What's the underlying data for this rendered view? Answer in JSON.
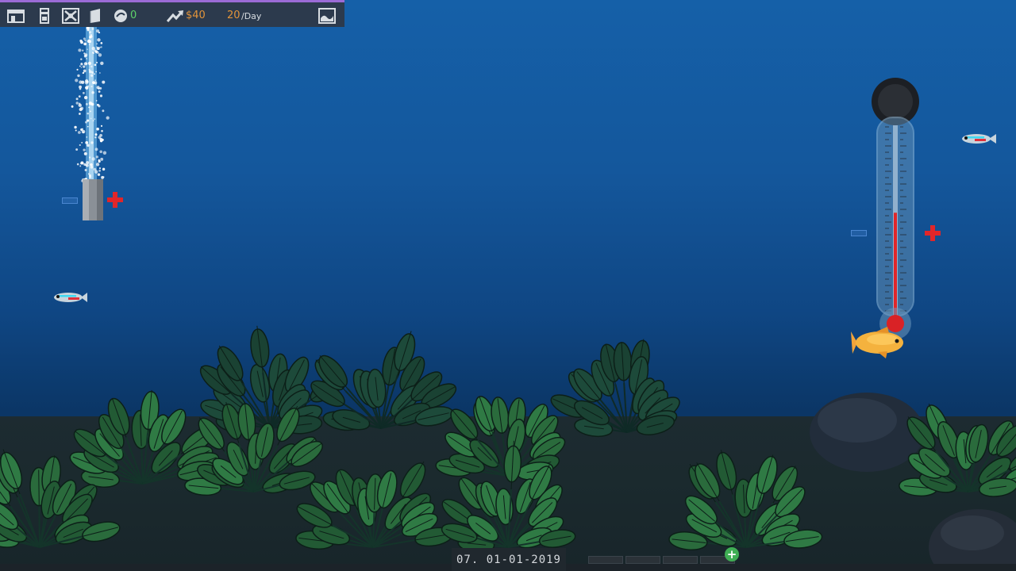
{
  "hud": {
    "pearl_count": "0",
    "money": "$40",
    "income_value": "20",
    "income_unit": "/Day",
    "icons": [
      "shop-icon",
      "equipment-icon",
      "fish-icon",
      "book-icon",
      "pearl-icon",
      "trend-up-icon",
      "tank-view-icon"
    ]
  },
  "date": "07. 01-01-2019",
  "colors": {
    "accent_bar": "#9b6bd6",
    "money": "#e2943a",
    "pearls": "#5dd36a",
    "plus": "#e0262a",
    "add": "#3fae54"
  },
  "bottom_slots": 4,
  "thermometer_fill_fraction": 0.55
}
